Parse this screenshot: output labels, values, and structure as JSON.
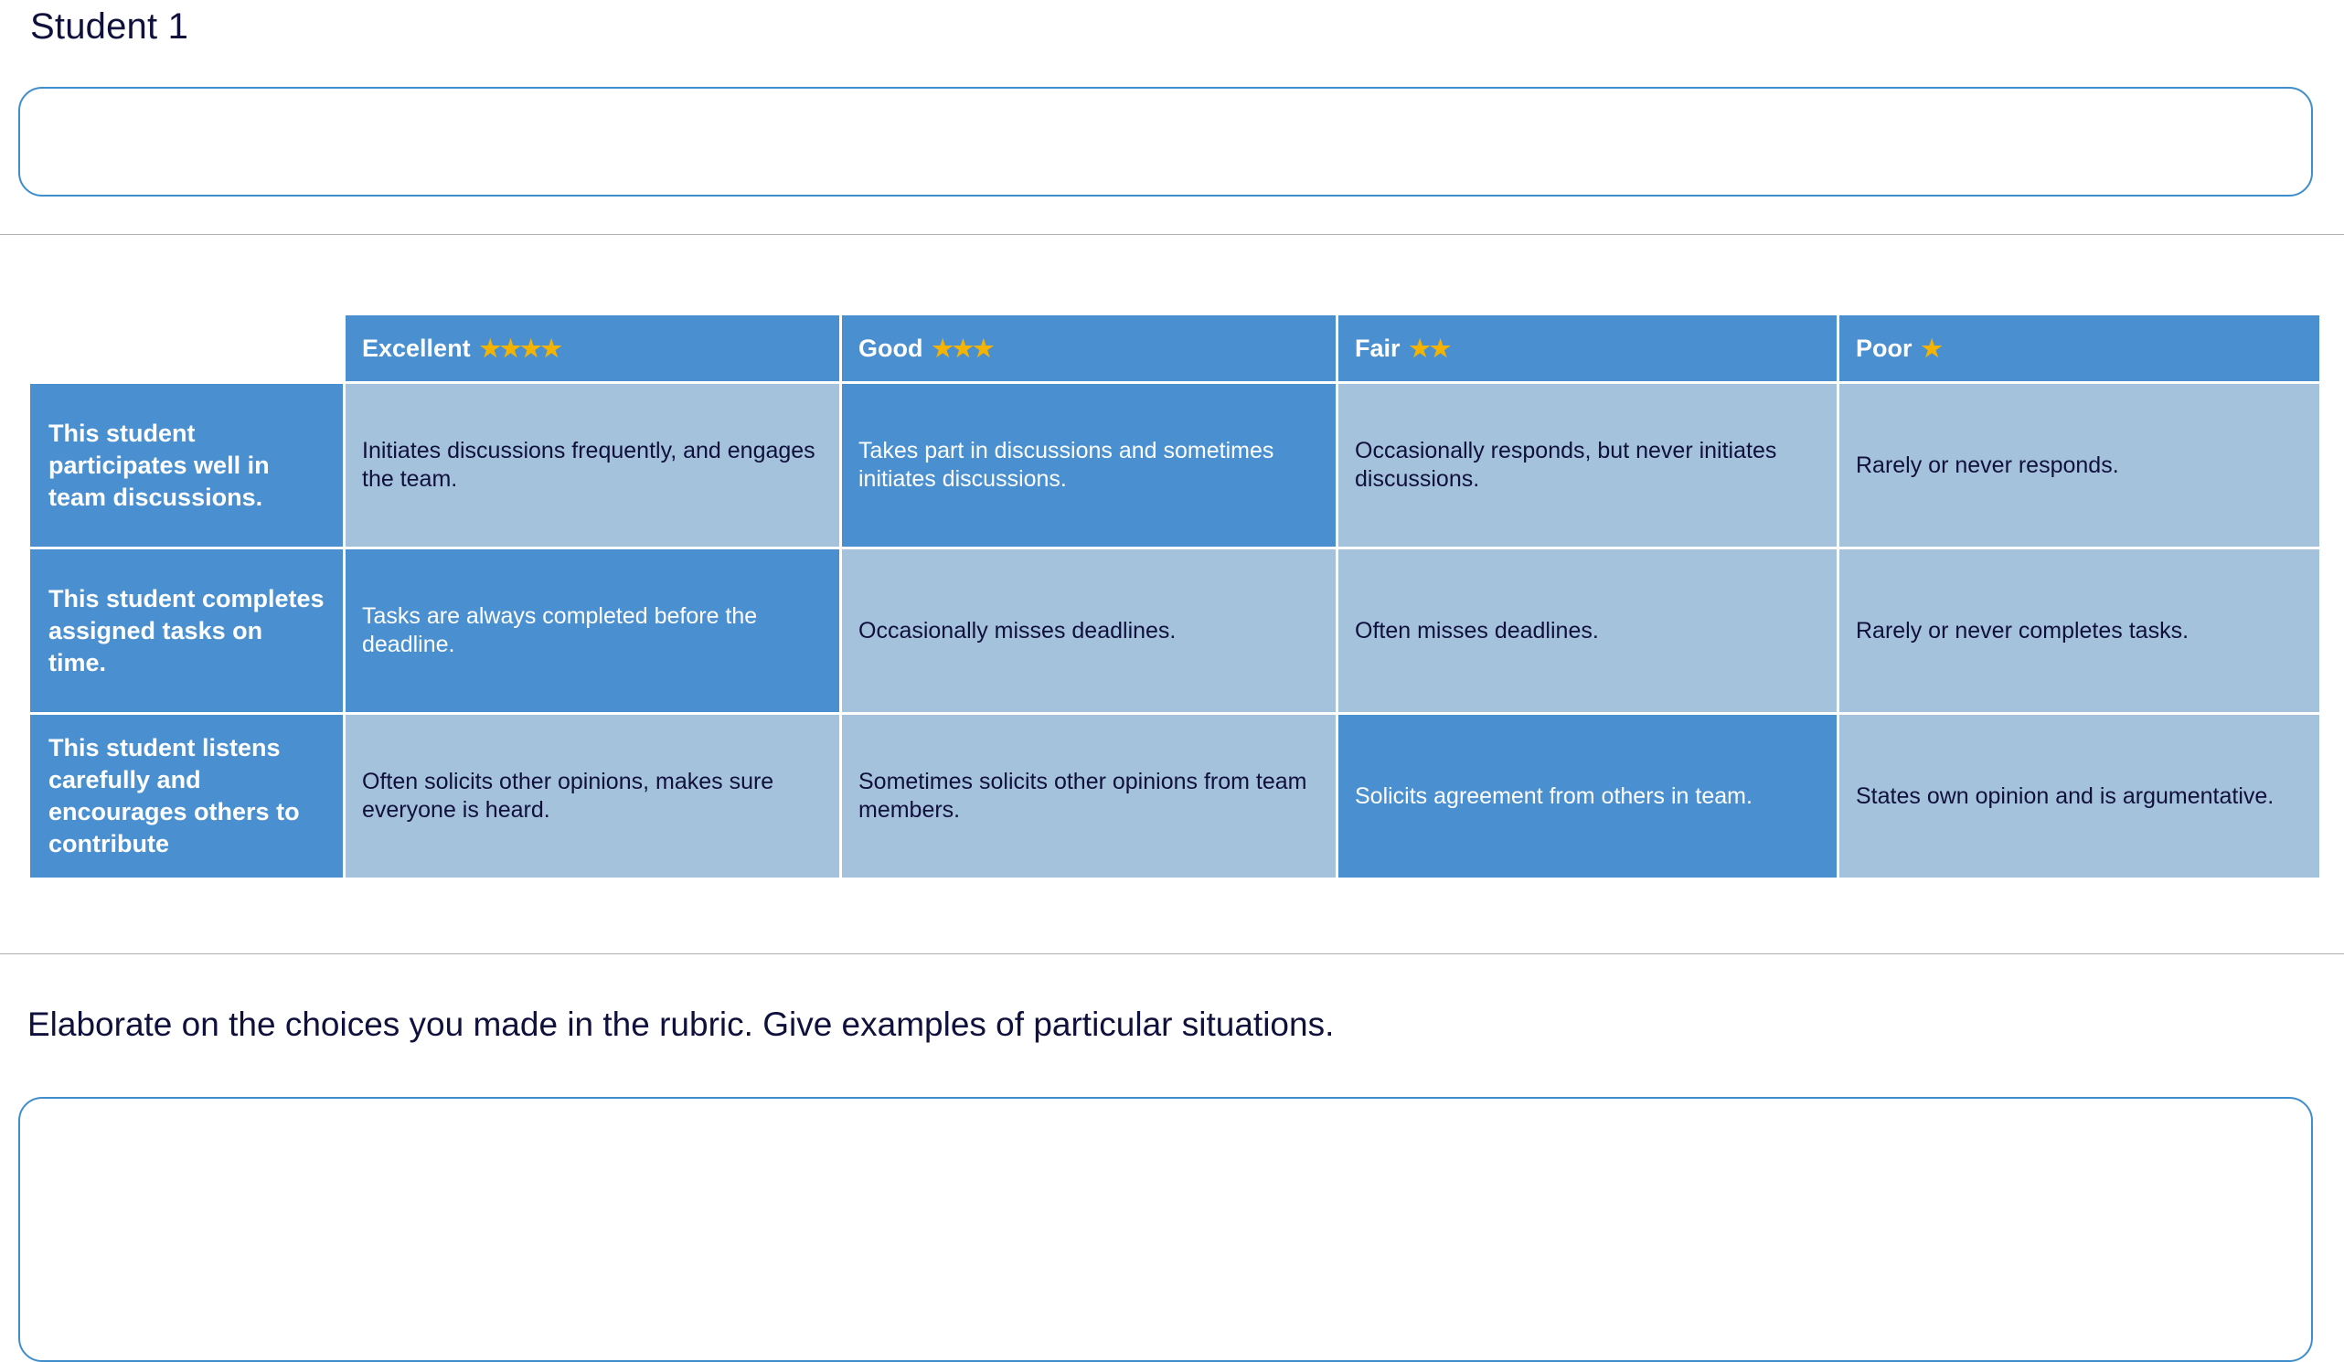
{
  "heading": {
    "student_label": "Student 1"
  },
  "top_answer": {
    "value": "",
    "placeholder": ""
  },
  "rubric": {
    "columns": [
      {
        "label": "Excellent",
        "stars": "★★★★",
        "star_count": 4
      },
      {
        "label": "Good",
        "stars": "★★★",
        "star_count": 3
      },
      {
        "label": "Fair",
        "stars": "★★",
        "star_count": 2
      },
      {
        "label": "Poor",
        "stars": "★",
        "star_count": 1
      }
    ],
    "rows": [
      {
        "criterion": "This student participates well in team discussions.",
        "selected_index": 1,
        "cells": [
          "Initiates discussions frequently, and engages the team.",
          "Takes part in discussions and sometimes initiates discussions.",
          "Occasionally responds, but never initiates discussions.",
          "Rarely or never responds."
        ]
      },
      {
        "criterion": "This student completes assigned tasks on time.",
        "selected_index": 0,
        "cells": [
          "Tasks are always completed before the deadline.",
          "Occasionally misses deadlines.",
          "Often misses deadlines.",
          "Rarely or never completes tasks."
        ]
      },
      {
        "criterion": "This student listens carefully and encourages others to contribute",
        "selected_index": 2,
        "cells": [
          "Often solicits other opinions, makes sure everyone is heard.",
          "Sometimes solicits other opinions from team members.",
          "Solicits agreement from others in team.",
          "States own opinion and is argumentative."
        ]
      }
    ]
  },
  "prompt": {
    "text": "Elaborate on the choices you made in the rubric. Give examples of particular situations."
  },
  "bottom_answer": {
    "value": "",
    "placeholder": ""
  },
  "colors": {
    "header_blue": "#4a90d0",
    "cell_blue": "#a5c2dd",
    "selected_blue": "#4a90d0",
    "text_dark": "#10103c",
    "border_blue": "#3f8ecb",
    "rule_gray": "#b3b3b3",
    "star_gold": "#f5b301"
  }
}
